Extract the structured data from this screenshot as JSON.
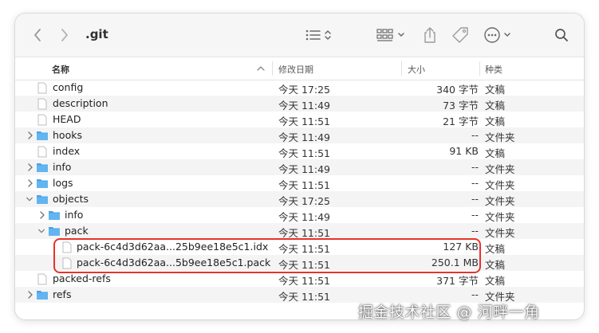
{
  "window": {
    "title": ".git"
  },
  "toolbar": {
    "back_icon": "chevron-left-icon",
    "forward_icon": "chevron-right-icon",
    "view_icon": "list-view-icon",
    "group_icon": "grid-group-icon",
    "share_icon": "share-icon",
    "tag_icon": "tag-icon",
    "more_icon": "ellipsis-circle-icon",
    "search_icon": "search-icon"
  },
  "columns": {
    "name": "名称",
    "date": "修改日期",
    "size": "大小",
    "kind": "种类"
  },
  "rows": [
    {
      "name": "config",
      "date": "今天 17:25",
      "size": "340 字节",
      "kind": "文稿"
    },
    {
      "name": "description",
      "date": "今天 11:49",
      "size": "73 字节",
      "kind": "文稿"
    },
    {
      "name": "HEAD",
      "date": "今天 11:51",
      "size": "21 字节",
      "kind": "文稿"
    },
    {
      "name": "hooks",
      "date": "今天 11:49",
      "size": "--",
      "kind": "文件夹"
    },
    {
      "name": "index",
      "date": "今天 11:51",
      "size": "91 KB",
      "kind": "文稿"
    },
    {
      "name": "info",
      "date": "今天 11:49",
      "size": "--",
      "kind": "文件夹"
    },
    {
      "name": "logs",
      "date": "今天 11:51",
      "size": "--",
      "kind": "文件夹"
    },
    {
      "name": "objects",
      "date": "今天 17:25",
      "size": "--",
      "kind": "文件夹"
    },
    {
      "name": "info",
      "date": "今天 11:49",
      "size": "--",
      "kind": "文件夹"
    },
    {
      "name": "pack",
      "date": "今天 11:51",
      "size": "--",
      "kind": "文件夹"
    },
    {
      "name": "pack-6c4d3d62aa...25b9ee18e5c1.idx",
      "date": "今天 11:51",
      "size": "127 KB",
      "kind": "文稿"
    },
    {
      "name": "pack-6c4d3d62aa...5b9ee18e5c1.pack",
      "date": "今天 11:51",
      "size": "250.1 MB",
      "kind": "文稿"
    },
    {
      "name": "packed-refs",
      "date": "今天 11:51",
      "size": "371 字节",
      "kind": "文稿"
    },
    {
      "name": "refs",
      "date": "今天 11:51",
      "size": "--",
      "kind": "文件夹"
    }
  ],
  "watermark": "掘金技术社区 @ 河畔一角",
  "colors": {
    "folder": "#4aa3e8",
    "highlight": "#e8322a",
    "toolbar_bg": "#f6f6f6"
  }
}
